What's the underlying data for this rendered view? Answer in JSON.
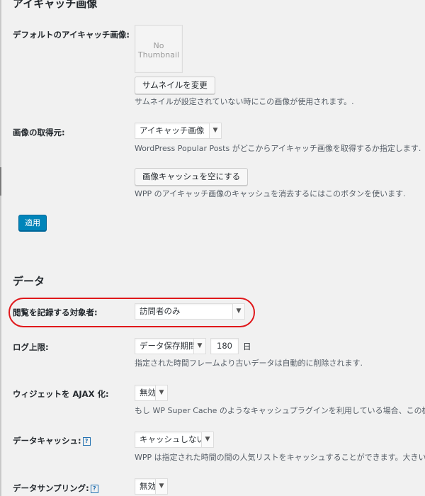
{
  "featured_image": {
    "section_title": "アイキャッチ画像",
    "default_label": "デフォルトのアイキャッチ画像:",
    "thumbnail_placeholder_line1": "No",
    "thumbnail_placeholder_line2": "Thumbnail",
    "change_button": "サムネイルを変更",
    "change_desc": "サムネイルが設定されていない時にこの画像が使用されます。.",
    "source_label": "画像の取得元:",
    "source_value": "アイキャッチ画像",
    "source_desc": "WordPress Popular Posts がどこからアイキャッチ画像を取得するか指定します.",
    "clear_cache_button": "画像キャッシュを空にする",
    "clear_cache_desc": "WPP のアイキャッチ画像のキャッシュを消去するにはこのボタンを使います.",
    "apply_button": "適用"
  },
  "data_section": {
    "section_title": "データ",
    "log_target_label": "閲覧を記録する対象者:",
    "log_target_value": "訪問者のみ",
    "log_limit_label": "ログ上限:",
    "log_limit_select": "データ保存期間",
    "log_limit_days": "180",
    "log_limit_unit": "日",
    "log_limit_desc": "指定された時間フレームより古いデータは自動的に削除されます.",
    "ajax_label": "ウィジェットを AJAX 化:",
    "ajax_value": "無効",
    "ajax_desc": "もし WP Super Cache のようなキャッシュプラグインを利用している場合、この機能",
    "cache_label": "データキャッシュ:",
    "cache_help": "?",
    "cache_value": "キャッシュしない",
    "cache_desc": "WPP は指定された時間の間の人気リストをキャッシュすることができます。大きい",
    "sampling_label": "データサンプリング:",
    "sampling_help": "?",
    "sampling_value": "無効"
  },
  "colors": {
    "primary_button": "#0085ba",
    "highlight_ring": "#e0181b",
    "background": "#f1f1f1"
  }
}
